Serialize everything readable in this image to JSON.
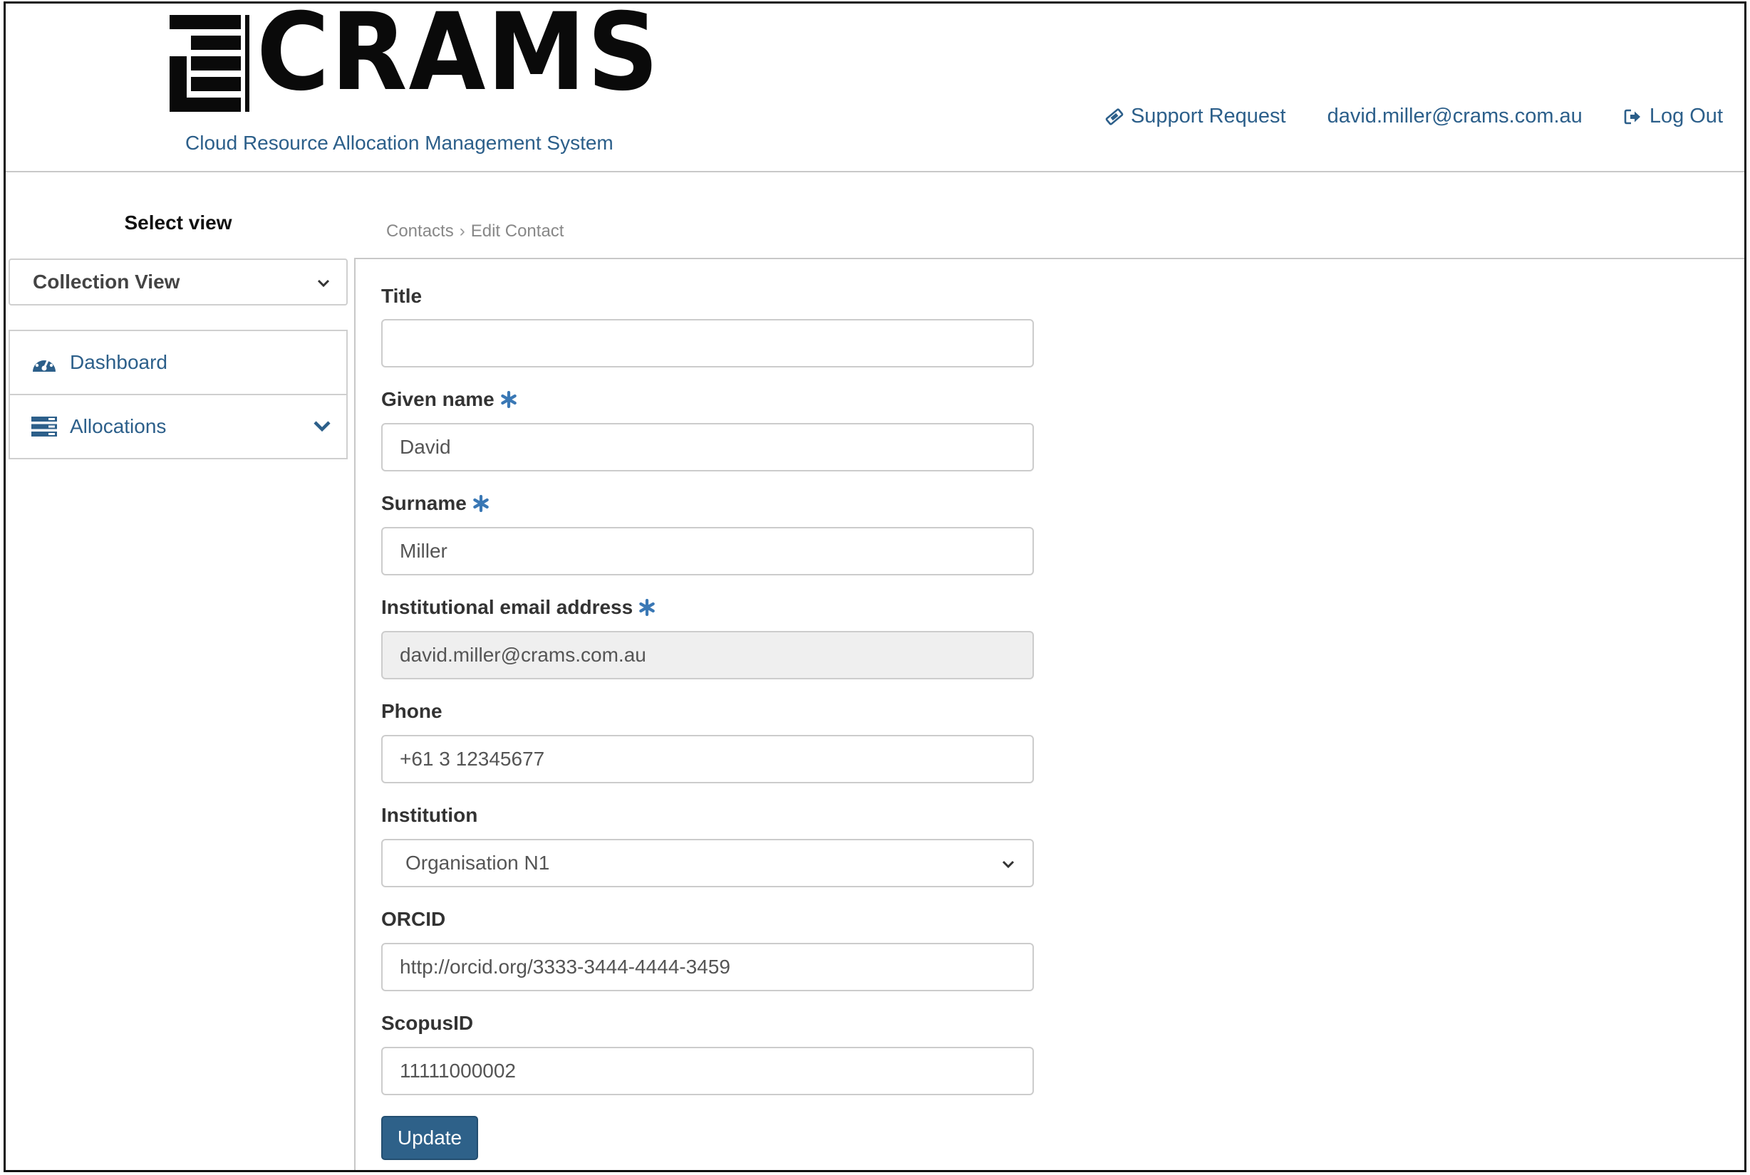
{
  "header": {
    "logo_text": "CRAMS",
    "tagline": "Cloud Resource Allocation Management System",
    "support_request": "Support Request",
    "user_email": "david.miller@crams.com.au",
    "log_out": "Log Out"
  },
  "sidebar": {
    "select_view_label": "Select view",
    "view_select_value": "Collection View",
    "items": [
      {
        "label": "Dashboard",
        "icon": "dashboard-icon"
      },
      {
        "label": "Allocations",
        "icon": "allocations-icon"
      }
    ]
  },
  "breadcrumb": {
    "items": [
      "Contacts",
      "Edit Contact"
    ],
    "separator": "›"
  },
  "form": {
    "title": {
      "label": "Title",
      "value": ""
    },
    "given_name": {
      "label": "Given name",
      "value": "David",
      "required": true
    },
    "surname": {
      "label": "Surname",
      "value": "Miller",
      "required": true
    },
    "email": {
      "label": "Institutional email address",
      "value": "david.miller@crams.com.au",
      "required": true,
      "readonly": true
    },
    "phone": {
      "label": "Phone",
      "value": "+61 3 12345677"
    },
    "institution": {
      "label": "Institution",
      "value": "Organisation N1"
    },
    "orcid": {
      "label": "ORCID",
      "value": "http://orcid.org/3333-3444-4444-3459"
    },
    "scopus": {
      "label": "ScopusID",
      "value": "11111000002"
    },
    "update_label": "Update"
  },
  "colors": {
    "accent": "#2c5f8a",
    "button": "#2e6189",
    "required_star": "#3a78b5"
  }
}
